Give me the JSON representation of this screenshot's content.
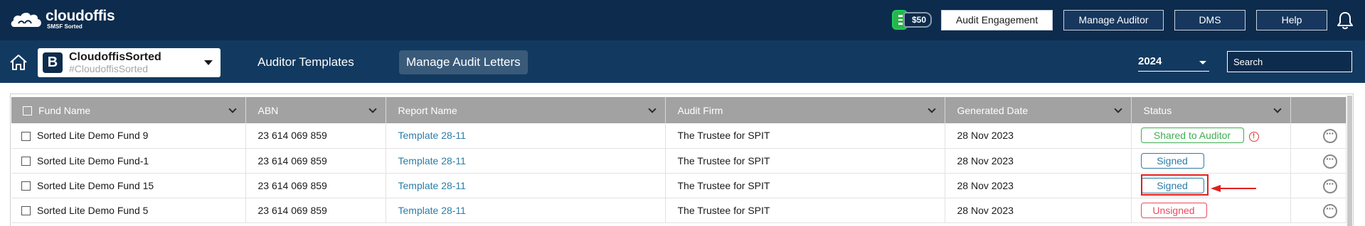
{
  "brand": {
    "name": "cloudoffis",
    "sub": "SMSF Sorted"
  },
  "credit": {
    "amount": "$50"
  },
  "topnav": {
    "audit_engagement": "Audit Engagement",
    "manage_auditor": "Manage Auditor",
    "dms": "DMS",
    "help": "Help"
  },
  "fund": {
    "badge": "B",
    "name": "CloudoffisSorted",
    "code": "#CloudoffisSorted"
  },
  "subnav": {
    "templates": "Auditor Templates",
    "letters": "Manage Audit Letters"
  },
  "year": "2024",
  "search": {
    "placeholder": "Search"
  },
  "table": {
    "columns": [
      "Fund Name",
      "ABN",
      "Report Name",
      "Audit Firm",
      "Generated Date",
      "Status"
    ],
    "rows": [
      {
        "fund": "Sorted Lite Demo Fund 9",
        "abn": "23 614 069 859",
        "report": "Template 28-11",
        "firm": "The Trustee for SPIT",
        "date": "28 Nov 2023",
        "status": "Shared to Auditor",
        "warn": "!"
      },
      {
        "fund": "Sorted Lite Demo Fund-1",
        "abn": "23 614 069 859",
        "report": "Template 28-11",
        "firm": "The Trustee for SPIT",
        "date": "28 Nov 2023",
        "status": "Signed"
      },
      {
        "fund": "Sorted Lite Demo Fund 15",
        "abn": "23 614 069 859",
        "report": "Template 28-11",
        "firm": "The Trustee for SPIT",
        "date": "28 Nov 2023",
        "status": "Signed"
      },
      {
        "fund": "Sorted Lite Demo Fund 5",
        "abn": "23 614 069 859",
        "report": "Template 28-11",
        "firm": "The Trustee for SPIT",
        "date": "28 Nov 2023",
        "status": "Unsigned"
      }
    ]
  },
  "colors": {
    "topbar": "#0d2b4c",
    "subbar": "#123a60",
    "header": "#a2a2a2",
    "link": "#2a7da8",
    "shared": "#3fae51",
    "unsigned": "#e84a5f",
    "annotation": "#e02020"
  }
}
